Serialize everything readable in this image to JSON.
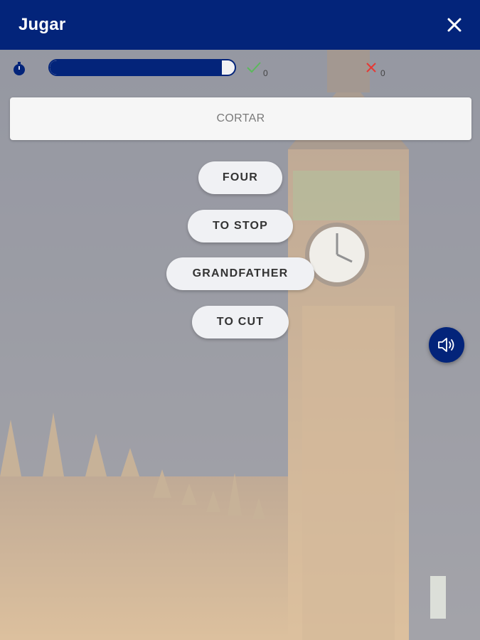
{
  "header": {
    "title": "Jugar",
    "close_icon": "close-icon"
  },
  "status": {
    "timer_icon": "stopwatch-icon",
    "progress_fraction": 0.93,
    "correct_count": "0",
    "wrong_count": "0",
    "correct_color": "#5cb85c",
    "wrong_color": "#e53935"
  },
  "prompt": {
    "word": "CORTAR"
  },
  "options": [
    {
      "label": "FOUR"
    },
    {
      "label": "TO STOP"
    },
    {
      "label": "GRANDFATHER"
    },
    {
      "label": "TO CUT"
    }
  ],
  "audio": {
    "icon": "speaker-icon"
  },
  "colors": {
    "primary": "#03247a",
    "card": "#f6f6f6"
  }
}
